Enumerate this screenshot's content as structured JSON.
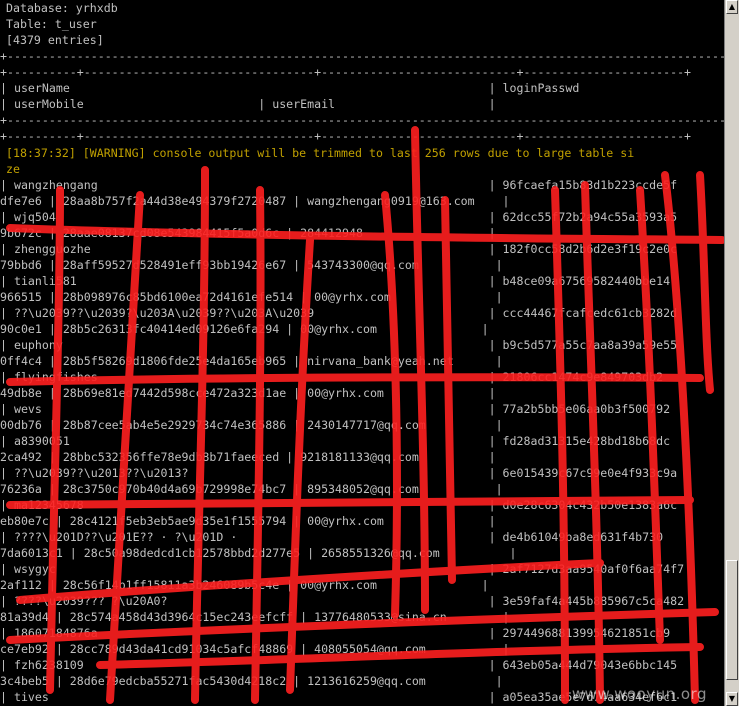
{
  "header": {
    "database": "Database: yrhxdb",
    "table": "Table: t_user",
    "entries": "[4379 entries]"
  },
  "table_header": {
    "border_top": "+-----------------------------------------------------------------------------------------------------------------+",
    "border_cols": "+----------+---------------------------------+----------------------------+-----------------------+",
    "row1": "| userName                                                            | loginPasswd",
    "row2": "| userMobile                         | userEmail                      |",
    "border_bottom": "+-----------------------------------------------------------------------------------------------------------------+"
  },
  "warning": {
    "line1": "[18:37:32] [WARNING] console output will be trimmed to last 256 rows due to large table si",
    "line2": "ze"
  },
  "rows": [
    {
      "a": "| wangzhengang                                                        | 96fcaefa15b83d1b223ccde5f",
      "b": "dfe7e6 | 28aa8b757f2a44d38e494379f2720487 | wangzhengang0919@163.com    |"
    },
    {
      "a": "| wjq504                                                              | 62dcc55f72b2a94c55a3593a5",
      "b": "9b672c | 28aae08137cd08e543984415f5a0d6c | 284412948                  |"
    },
    {
      "a": "| zhengguozhe                                                         | 182f0cc58d2b6d2e3f19c2e0c",
      "b": "79bbd6 | 28aff59527d528491eff93bb19426e67 | 543743300@qq.com           |"
    },
    {
      "a": "| tianli581                                                           | b48ce09a67569582440bbe14",
      "b": "966515 | 28b098976c85bd6100ea72d4161efe514 | 00@yrhx.com               |"
    },
    {
      "a": "| ??\\u2039??\\u2039?\\u203A\\u2039??\\u203A\\u2039                         | ccc44467fcafcedc61cb3282d",
      "b": "90c0e1 | 28b5c26313fc40414ed09126e6fa294 | 00@yrhx.com               |"
    },
    {
      "a": "| euphony                                                             | b9c5d577a55c7aa8a39a59e55",
      "b": "0ff4c4 | 28b5f58269d1806fde25e4da165eb965 | nirvana_bank@yeah.net      |"
    },
    {
      "a": "| flyingfishes                                                        | 21806cc1474c9e849703db2",
      "b": "49db8e | 28b69e81ed7442d598cce472a323d1ae | 00@yrhx.com               |"
    },
    {
      "a": "| wevs                                                                | 77a2b5bb5e06aa0b3f500792",
      "b": "00db76 | 28b87cee5ab4e5e2929734c74e365886 | 2430147717@qq.com          |"
    },
    {
      "a": "| a8390051                                                            | fd28ad31315e428bd18b68dc",
      "b": "2ca492 | 28bbc532356ffe78e9db8b71faeeced | 9218181133@qq.com          |"
    },
    {
      "a": "| ??\\u2039??\\u2013??\\u2013?                                           | 6e015439c67c99e0e4f933c9a",
      "b": "76236a | 28c3750c970b40d4a69b729998e74bc7 | 895348052@qq.com           |"
    },
    {
      "a": "| ma12345678                                                          | d0e28c6304c432b50e1383a6c",
      "b": "eb80e7c | 28c4121f5eb3eb5ae9d35e1f1555794 | 00@yrhx.com               |"
    },
    {
      "a": "| ????\\u201D??\\u201E?? · ?\\u201D ·                                    | de4b61049ba8ed631f4b730",
      "b": "7da6013c1 | 28c50a98dedcd1cb12578bbd2d277e5 | 2658551326@qq.com          |"
    },
    {
      "a": "| wsygyc                                                              | 2af7127d3aa9540af0f6aa74f7",
      "b": "2af112 | 28c56f14b1ff15811a3b246089b5c4e | 00@yrhx.com               |"
    },
    {
      "a": "| ????\\u2039??? ?\\u20A0?                                              | 3e59faf4a445b885967c5ca482",
      "b": "81a39d4 | 28c574a458d43d3964c15ec243eefcff | 13776480533@sina.cn        |"
    },
    {
      "a": "| 18607184876a                                                        | 297449688139954621851cb9",
      "b": "ce7eb92 | 28cc789d43da41cd91034c5afcf48869 | 408055054@qq.com           |"
    },
    {
      "a": "| fzh6238109                                                          | 643eb05a444d79043e6bbc145",
      "b": "3c4beb5 | 28d6e79edcba55271fac5430d4218c2 | 1213616259@qq.com          |"
    },
    {
      "a": "| tives                                                               | a05ea35ae5e7d74aa634ef6c1",
      "b": ""
    }
  ],
  "watermark": "www.wooyun.org",
  "scrollbar": {
    "up_arrow": "▲",
    "down_arrow": "▼"
  },
  "colors": {
    "background": "#000000",
    "text": "#c0c0c0",
    "warning": "#c0a000",
    "redaction": "#ff0000"
  }
}
